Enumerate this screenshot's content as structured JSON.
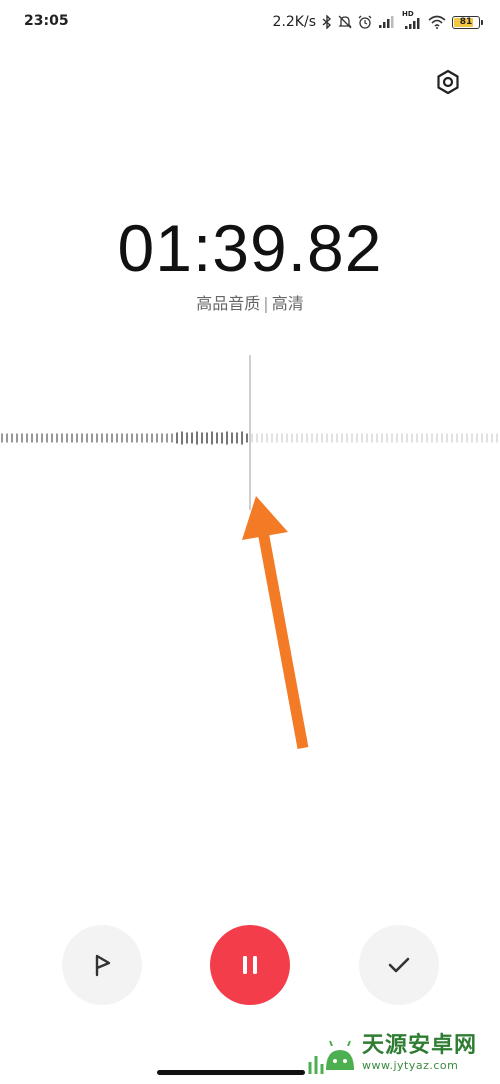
{
  "status_bar": {
    "time": "23:05",
    "net_speed": "2.2K/s",
    "hd_label": "HD",
    "battery_level": "81",
    "battery_fraction": 0.81,
    "battery_color": "#f3c744"
  },
  "recorder": {
    "elapsed": "01:39.82",
    "quality_primary": "高品音质",
    "quality_separator": "|",
    "quality_secondary": "高清"
  },
  "controls": {
    "flag_icon": "flag-icon",
    "pause_icon": "pause-icon",
    "done_icon": "check-icon",
    "pause_color": "#f43d4a"
  },
  "annotation": {
    "arrow_color": "#f47b25"
  },
  "watermark": {
    "title": "天源安卓网",
    "url": "www.jytyaz.com"
  }
}
